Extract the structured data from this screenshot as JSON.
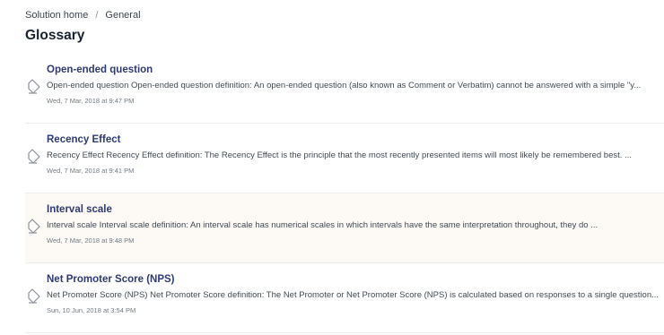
{
  "breadcrumb": {
    "home": "Solution home",
    "separator": "/",
    "current": "General"
  },
  "page": {
    "title": "Glossary"
  },
  "articles": [
    {
      "title": "Open-ended question",
      "description": "Open-ended question Open-ended question definition: An open-ended question (also known as Comment or Verbatim) cannot be answered with a simple \"y...",
      "date": "Wed, 7 Mar, 2018 at 9:47 PM",
      "icon": "article-icon"
    },
    {
      "title": "Recency Effect",
      "description": "Recency Effect Recency Effect definition: The Recency Effect is the principle that the most recently presented items will most likely be remembered best. ...",
      "date": "Wed, 7 Mar, 2018 at 9:41 PM",
      "icon": "article-icon"
    },
    {
      "title": "Interval scale",
      "description": "Interval scale Interval scale definition: An interval scale has numerical scales in which intervals have the same interpretation throughout, they do ...",
      "date": "Wed, 7 Mar, 2018 at 9:48 PM",
      "icon": "article-icon"
    },
    {
      "title": "Net Promoter Score (NPS)",
      "description": "Net Promoter Score (NPS) Net Promoter Score definition: The Net Promoter or Net Promoter Score (NPS) is calculated based on responses to a single question...",
      "date": "Sun, 10 Jun, 2018 at 3:54 PM",
      "icon": "article-icon"
    }
  ],
  "colors": {
    "title_link": "#2f3a73",
    "hover_row": "#fdf9f5",
    "divider": "#eceef0"
  }
}
